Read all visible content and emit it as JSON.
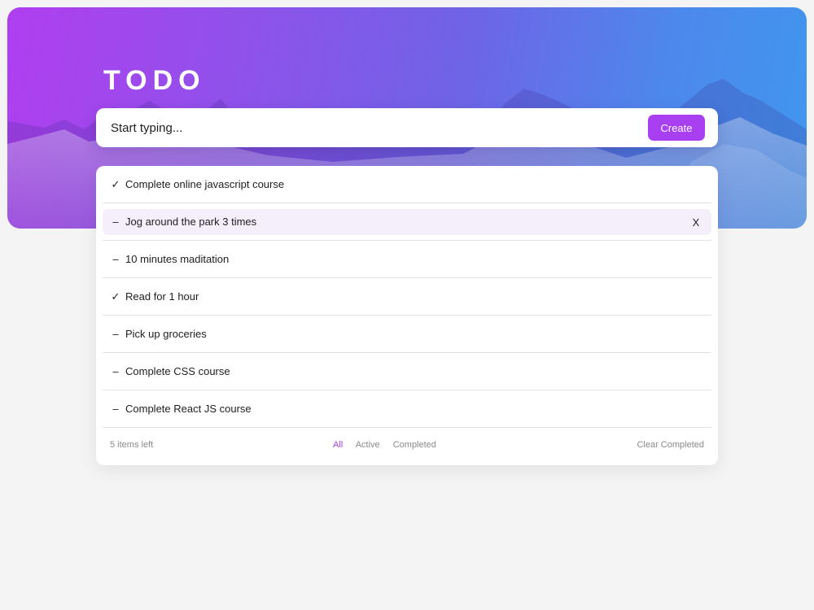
{
  "header": {
    "title": "TODO"
  },
  "create": {
    "placeholder": "Start typing...",
    "button_label": "Create"
  },
  "todos": [
    {
      "text": "Complete online javascript course",
      "status": "completed",
      "status_symbol": "✓"
    },
    {
      "text": "Jog around the park 3 times",
      "status": "active",
      "status_symbol": "–",
      "highlighted": true,
      "delete_symbol": "X"
    },
    {
      "text": "10 minutes maditation",
      "status": "active",
      "status_symbol": "–"
    },
    {
      "text": "Read for 1 hour",
      "status": "completed",
      "status_symbol": "✓"
    },
    {
      "text": "Pick up groceries",
      "status": "active",
      "status_symbol": "–"
    },
    {
      "text": "Complete CSS course",
      "status": "active",
      "status_symbol": "–"
    },
    {
      "text": "Complete React JS course",
      "status": "active",
      "status_symbol": "–"
    }
  ],
  "footer": {
    "items_left": "5 items left",
    "filters": [
      "All",
      "Active",
      "Completed"
    ],
    "active_filter": "All",
    "clear_label": "Clear Completed"
  },
  "icons": {
    "completed": "checkmark-icon",
    "active": "dash-icon",
    "delete": "close-icon"
  },
  "colors": {
    "accent": "#a83ff0",
    "hero_gradient_start": "#b03ef0",
    "hero_gradient_end": "#3f97ee",
    "highlight_row": "#f5effc",
    "page_background": "#f4f4f4"
  }
}
